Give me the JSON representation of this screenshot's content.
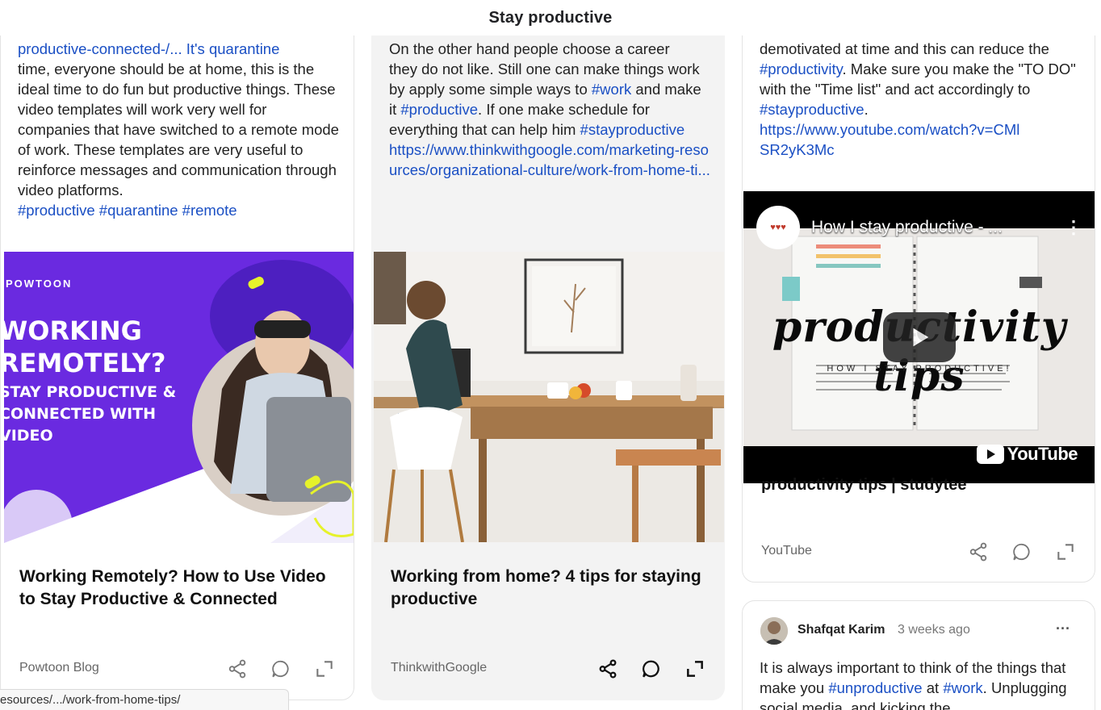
{
  "header": {
    "title": "Stay productive"
  },
  "col1": {
    "cut_line": "productive-connected-/... It's quarantine",
    "text": "time, everyone should be at home, this is the ideal time to do fun but productive things. These video templates will work very well for companies that have switched to a remote mode of work. These templates are very useful to reinforce messages and communication through video platforms.",
    "tags": [
      "#productive",
      "#quarantine",
      "#remote"
    ],
    "image": {
      "brand": "POWTOON",
      "line1": "WORKING",
      "line2": "REMOTELY?",
      "line3": "STAY PRODUCTIVE &",
      "line4": "CONNECTED WITH",
      "line5": "VIDEO"
    },
    "title": "Working Remotely? How to Use Video to Stay Productive & Connected",
    "source": "Powtoon Blog"
  },
  "col2": {
    "cut_line": "On the other hand people choose a career",
    "text_a": "they do not like. Still one can make things work by apply some simple ways to",
    "tag_work": "#work",
    "text_b": "and make it",
    "tag_productive": "#productive",
    "text_c": ". If one make schedule for everything that can help him",
    "tag_stay": "#stayproductive",
    "link": "https://www.thinkwithgoogle.com/marketing-resources/organizational-culture/work-from-home-ti...",
    "title": "Working from home? 4 tips for staying productive",
    "source": "ThinkwithGoogle"
  },
  "col3": {
    "cut_line": "demotivated at time and this can reduce the",
    "tag_productivity": "#productivity",
    "text_a": ". Make sure you make the \"TO DO\" with the \"Time list\" and act accordingly to",
    "tag_stay": "#stayproductive",
    "text_b": ".",
    "link": "https://www.youtube.com/watch?v=CMlSR2yK3Mc",
    "video": {
      "title": "How I stay productive - ...",
      "overlay_script": "productivity tips",
      "overlay_sub": "HOW I STAY PRODUCTIVE!",
      "youtube_label": "YouTube"
    },
    "title_cut": "productivity tips | studytee",
    "source": "YouTube"
  },
  "post": {
    "author": "Shafqat Karim",
    "time": "3 weeks ago",
    "text_a": "It is always important to think of the things that make you",
    "tag_unproductive": "#unproductive",
    "text_b": "at",
    "tag_work": "#work",
    "text_c": ". Unplugging social media, and kicking the"
  },
  "status_url": "esources/.../work-from-home-tips/",
  "colors": {
    "link": "#1a4fc4",
    "powtoon_purple": "#6a2ae0",
    "accent_yellow": "#e6f22a"
  },
  "icons": [
    "share-icon",
    "comment-icon",
    "expand-icon",
    "play-icon",
    "more-icon"
  ]
}
